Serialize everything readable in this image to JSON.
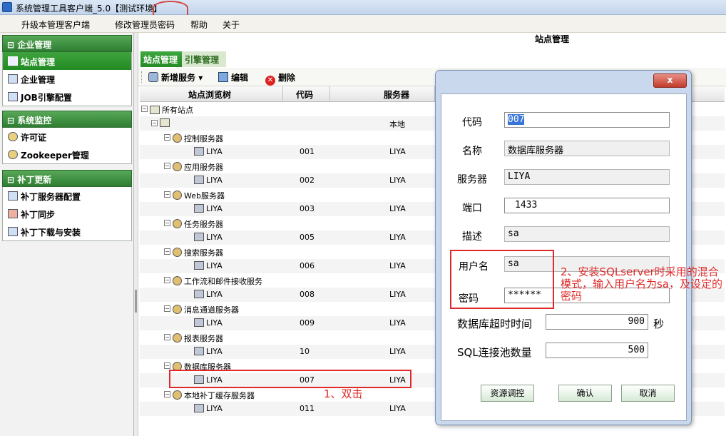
{
  "window": {
    "title": "系统管理工具客户端_5.0【测试环境】"
  },
  "menu": {
    "items": [
      "升级本管理客户端",
      "修改管理员密码",
      "帮助",
      "关于"
    ]
  },
  "sidebar": {
    "groups": [
      {
        "title": "企业管理",
        "items": [
          "站点管理",
          "企业管理",
          "JOB引擎配置"
        ]
      },
      {
        "title": "系统监控",
        "items": [
          "许可证",
          "Zookeeper管理"
        ]
      },
      {
        "title": "补丁更新",
        "items": [
          "补丁服务器配置",
          "补丁同步",
          "补丁下载与安装"
        ]
      }
    ]
  },
  "page": {
    "title": "站点管理",
    "tabs": [
      "站点管理",
      "引擎管理"
    ]
  },
  "toolbar": {
    "add": "新增服务",
    "edit": "编辑",
    "delete": "删除"
  },
  "grid": {
    "headers": [
      "站点浏览树",
      "代码",
      "服务器"
    ],
    "rows": [
      {
        "label": "所有站点",
        "code": "",
        "server": ""
      },
      {
        "label": "",
        "code": "",
        "server": "本地"
      },
      {
        "label": "控制服务器",
        "code": "",
        "server": ""
      },
      {
        "label": "LIYA",
        "code": "001",
        "server": "LIYA"
      },
      {
        "label": "应用服务器",
        "code": "",
        "server": ""
      },
      {
        "label": "LIYA",
        "code": "002",
        "server": "LIYA"
      },
      {
        "label": "Web服务器",
        "code": "",
        "server": ""
      },
      {
        "label": "LIYA",
        "code": "003",
        "server": "LIYA"
      },
      {
        "label": "任务服务器",
        "code": "",
        "server": ""
      },
      {
        "label": "LIYA",
        "code": "005",
        "server": "LIYA"
      },
      {
        "label": "搜索服务器",
        "code": "",
        "server": ""
      },
      {
        "label": "LIYA",
        "code": "006",
        "server": "LIYA"
      },
      {
        "label": "工作流和邮件接收服务",
        "code": "",
        "server": ""
      },
      {
        "label": "LIYA",
        "code": "008",
        "server": "LIYA"
      },
      {
        "label": "消息通道服务器",
        "code": "",
        "server": ""
      },
      {
        "label": "LIYA",
        "code": "009",
        "server": "LIYA"
      },
      {
        "label": "报表服务器",
        "code": "",
        "server": ""
      },
      {
        "label": "LIYA",
        "code": "10",
        "server": "LIYA"
      },
      {
        "label": "数据库服务器",
        "code": "",
        "server": ""
      },
      {
        "label": "LIYA",
        "code": "007",
        "server": "LIYA"
      },
      {
        "label": "本地补丁缓存服务器",
        "code": "",
        "server": ""
      },
      {
        "label": "LIYA",
        "code": "011",
        "server": "LIYA"
      }
    ]
  },
  "annotations": {
    "step1": "1、双击",
    "step2": "2、安装SQLserver时采用的混合模式，输入用户名为sa，及设定的密码"
  },
  "dialog": {
    "close": "x",
    "code_label": "代码",
    "code": "007",
    "name_label": "名称",
    "name": "数据库服务器",
    "server_label": "服务器",
    "server": "LIYA",
    "port_label": "端口",
    "port": "1433",
    "desc_label": "描述",
    "desc": "sa",
    "user_label": "用户名",
    "user": "sa",
    "pass_label": "密码",
    "pass": "******",
    "timeout_label": "数据库超时时间",
    "timeout": "900",
    "timeout_unit": "秒",
    "pool_label": "SQL连接池数量",
    "pool": "500",
    "btn_resource": "资源调控",
    "btn_ok": "确认",
    "btn_cancel": "取消"
  }
}
